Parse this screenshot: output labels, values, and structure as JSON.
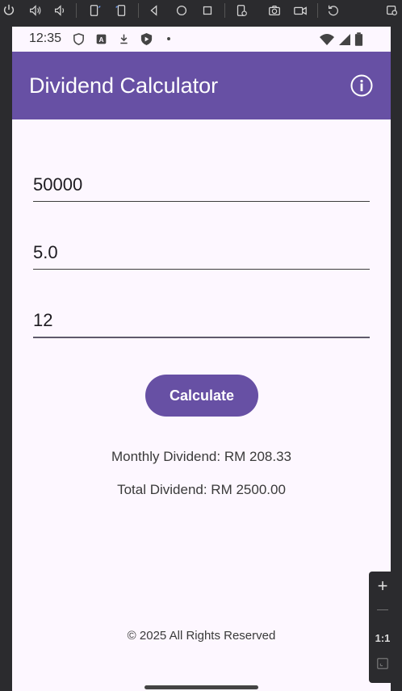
{
  "emulator_toolbar": {
    "icons": [
      "power-icon",
      "volume-up-icon",
      "volume-down-icon",
      "rotate-left-icon",
      "rotate-right-icon",
      "back-icon",
      "home-icon",
      "overview-icon",
      "fold-icon",
      "camera-icon",
      "screen-record-icon",
      "replay-icon",
      "snapshot-icon"
    ]
  },
  "status_bar": {
    "time": "12:35",
    "left_icons": [
      "shield-icon",
      "a-icon",
      "download-icon",
      "play-protect-icon",
      "dot-icon"
    ],
    "right_icons": [
      "wifi-icon",
      "signal-icon",
      "battery-icon"
    ]
  },
  "app_bar": {
    "title": "Dividend Calculator",
    "info_icon": "info-icon"
  },
  "form": {
    "investment_value": "50000",
    "rate_value": "5.0",
    "months_value": "12"
  },
  "actions": {
    "calculate_label": "Calculate"
  },
  "results": {
    "monthly": "Monthly Dividend: RM 208.33",
    "total": "Total Dividend: RM 2500.00"
  },
  "footer": {
    "text": "© 2025 All Rights Reserved"
  },
  "zoom_panel": {
    "zoom_in": "+",
    "zoom_out": "—",
    "actual_size": "1:1"
  },
  "colors": {
    "primary": "#6750a4",
    "background": "#fdf7ff",
    "on_primary": "#ffffff"
  }
}
